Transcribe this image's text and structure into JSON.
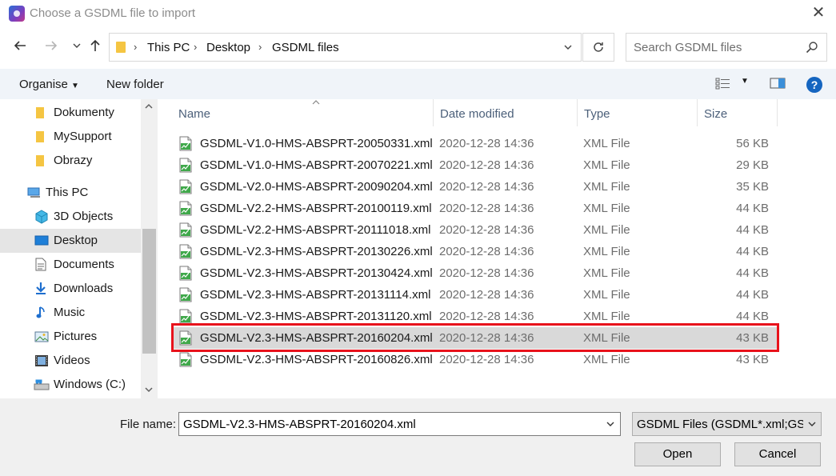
{
  "window": {
    "title": "Choose a GSDML file to import"
  },
  "address": {
    "breadcrumbs": [
      "This PC",
      "Desktop",
      "GSDML files"
    ]
  },
  "search": {
    "placeholder": "Search GSDML files"
  },
  "toolbar": {
    "organise_label": "Organise",
    "new_folder_label": "New folder",
    "help_label": "?"
  },
  "navpane": {
    "items": [
      {
        "label": "Dokumenty",
        "icon": "folder-icon"
      },
      {
        "label": "MySupport",
        "icon": "folder-icon"
      },
      {
        "label": "Obrazy",
        "icon": "folder-icon"
      },
      {
        "label": "This PC",
        "icon": "computer-icon"
      },
      {
        "label": "3D Objects",
        "icon": "cube-icon"
      },
      {
        "label": "Desktop",
        "icon": "desktop-icon",
        "selected": true
      },
      {
        "label": "Documents",
        "icon": "document-icon"
      },
      {
        "label": "Downloads",
        "icon": "download-icon"
      },
      {
        "label": "Music",
        "icon": "music-icon"
      },
      {
        "label": "Pictures",
        "icon": "picture-icon"
      },
      {
        "label": "Videos",
        "icon": "video-icon"
      },
      {
        "label": "Windows (C:)",
        "icon": "drive-icon"
      }
    ]
  },
  "filelist": {
    "columns": {
      "name": "Name",
      "date": "Date modified",
      "type": "Type",
      "size": "Size"
    },
    "rows": [
      {
        "name": "GSDML-V1.0-HMS-ABSPRT-20050331.xml",
        "date": "2020-12-28 14:36",
        "type": "XML File",
        "size": "56 KB"
      },
      {
        "name": "GSDML-V1.0-HMS-ABSPRT-20070221.xml",
        "date": "2020-12-28 14:36",
        "type": "XML File",
        "size": "29 KB"
      },
      {
        "name": "GSDML-V2.0-HMS-ABSPRT-20090204.xml",
        "date": "2020-12-28 14:36",
        "type": "XML File",
        "size": "35 KB"
      },
      {
        "name": "GSDML-V2.2-HMS-ABSPRT-20100119.xml",
        "date": "2020-12-28 14:36",
        "type": "XML File",
        "size": "44 KB"
      },
      {
        "name": "GSDML-V2.2-HMS-ABSPRT-20111018.xml",
        "date": "2020-12-28 14:36",
        "type": "XML File",
        "size": "44 KB"
      },
      {
        "name": "GSDML-V2.3-HMS-ABSPRT-20130226.xml",
        "date": "2020-12-28 14:36",
        "type": "XML File",
        "size": "44 KB"
      },
      {
        "name": "GSDML-V2.3-HMS-ABSPRT-20130424.xml",
        "date": "2020-12-28 14:36",
        "type": "XML File",
        "size": "44 KB"
      },
      {
        "name": "GSDML-V2.3-HMS-ABSPRT-20131114.xml",
        "date": "2020-12-28 14:36",
        "type": "XML File",
        "size": "44 KB"
      },
      {
        "name": "GSDML-V2.3-HMS-ABSPRT-20131120.xml",
        "date": "2020-12-28 14:36",
        "type": "XML File",
        "size": "44 KB"
      },
      {
        "name": "GSDML-V2.3-HMS-ABSPRT-20160204.xml",
        "date": "2020-12-28 14:36",
        "type": "XML File",
        "size": "43 KB",
        "selected": true
      },
      {
        "name": "GSDML-V2.3-HMS-ABSPRT-20160826.xml",
        "date": "2020-12-28 14:36",
        "type": "XML File",
        "size": "43 KB"
      }
    ]
  },
  "footer": {
    "filename_label": "File name:",
    "filename_value": "GSDML-V2.3-HMS-ABSPRT-20160204.xml",
    "filter_value": "GSDML Files (GSDML*.xml;GSDML*.XML)",
    "open_label": "Open",
    "cancel_label": "Cancel"
  },
  "colors": {
    "highlight": "#e8121b",
    "accent": "#1565c0",
    "selected_row": "#d9d9d9"
  }
}
